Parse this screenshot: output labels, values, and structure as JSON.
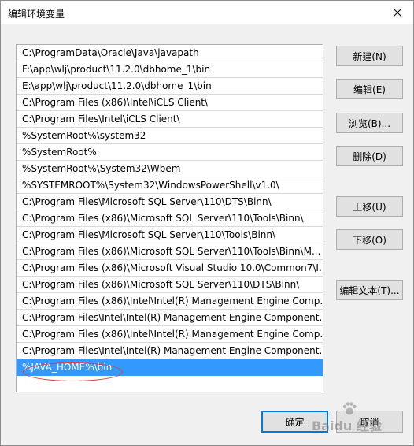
{
  "dialog": {
    "title": "编辑环境变量"
  },
  "list": {
    "items": [
      "C:\\ProgramData\\Oracle\\Java\\javapath",
      "F:\\app\\wlj\\product\\11.2.0\\dbhome_1\\bin",
      "E:\\app\\wlj\\product\\11.2.0\\dbhome_1\\bin",
      "C:\\Program Files (x86)\\Intel\\iCLS Client\\",
      "C:\\Program Files\\Intel\\iCLS Client\\",
      "%SystemRoot%\\system32",
      "%SystemRoot%",
      "%SystemRoot%\\System32\\Wbem",
      "%SYSTEMROOT%\\System32\\WindowsPowerShell\\v1.0\\",
      "C:\\Program Files\\Microsoft SQL Server\\110\\DTS\\Binn\\",
      "C:\\Program Files (x86)\\Microsoft SQL Server\\110\\Tools\\Binn\\",
      "C:\\Program Files\\Microsoft SQL Server\\110\\Tools\\Binn\\",
      "C:\\Program Files (x86)\\Microsoft SQL Server\\110\\Tools\\Binn\\M...",
      "C:\\Program Files (x86)\\Microsoft Visual Studio 10.0\\Common7\\I...",
      "C:\\Program Files (x86)\\Microsoft SQL Server\\110\\DTS\\Binn\\",
      "C:\\Program Files (x86)\\Intel\\Intel(R) Management Engine Comp...",
      "C:\\Program Files\\Intel\\Intel(R) Management Engine Component...",
      "C:\\Program Files (x86)\\Intel\\Intel(R) Management Engine Comp...",
      "C:\\Program Files\\Intel\\Intel(R) Management Engine Component...",
      "%JAVA_HOME%\\bin"
    ],
    "selected_index": 19
  },
  "buttons": {
    "new": "新建(N)",
    "edit": "编辑(E)",
    "browse": "浏览(B)...",
    "delete": "删除(D)",
    "move_up": "上移(U)",
    "move_down": "下移(O)",
    "edit_text": "编辑文本(T)...",
    "ok": "确定",
    "cancel": "取消"
  },
  "watermark": {
    "text": "Baidu 经验"
  },
  "colors": {
    "selection": "#3399ff",
    "annotation": "#e23a3a",
    "default_button_border": "#0078d7"
  }
}
